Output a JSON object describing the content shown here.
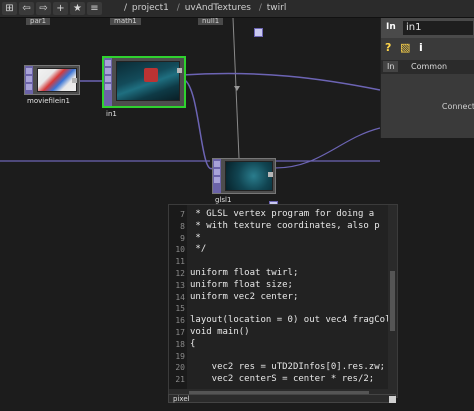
{
  "toolbar": {
    "buttons": [
      "⊞",
      "⇦",
      "⇨",
      "+",
      "★",
      "≡"
    ],
    "path": [
      "/",
      "project1",
      "/",
      "uvAndTextures",
      "/",
      "twirl"
    ]
  },
  "network": {
    "top_labels": [
      "par1",
      "math1",
      "null1"
    ],
    "nodes": {
      "moviefilein1": "moviefilein1",
      "in1": "in1",
      "glsl1": "glsl1"
    }
  },
  "params": {
    "type_label": "In",
    "name": "in1",
    "tabs": [
      "In",
      "Common"
    ],
    "connect_label": "Connect"
  },
  "editor": {
    "line_numbers": [
      "7",
      "8",
      "9",
      "10",
      "11",
      "12",
      "13",
      "14",
      "15",
      "16",
      "17",
      "18",
      "19",
      "20",
      "21"
    ],
    "lines": [
      " * GLSL vertex program for doing a",
      " * with texture coordinates, also p",
      " *",
      " */",
      "",
      "uniform float twirl;",
      "uniform float size;",
      "uniform vec2 center;",
      "",
      "layout(location = 0) out vec4 fragCol",
      "void main()",
      "{",
      "",
      "    vec2 res = uTD2DInfos[0].res.zw;",
      "    vec2 centerS = center * res/2;"
    ],
    "footer": "pixel"
  },
  "colors": {
    "selected_node": "#2fd12f",
    "wire": "#6c64b4",
    "flags": "#6b63a8"
  }
}
